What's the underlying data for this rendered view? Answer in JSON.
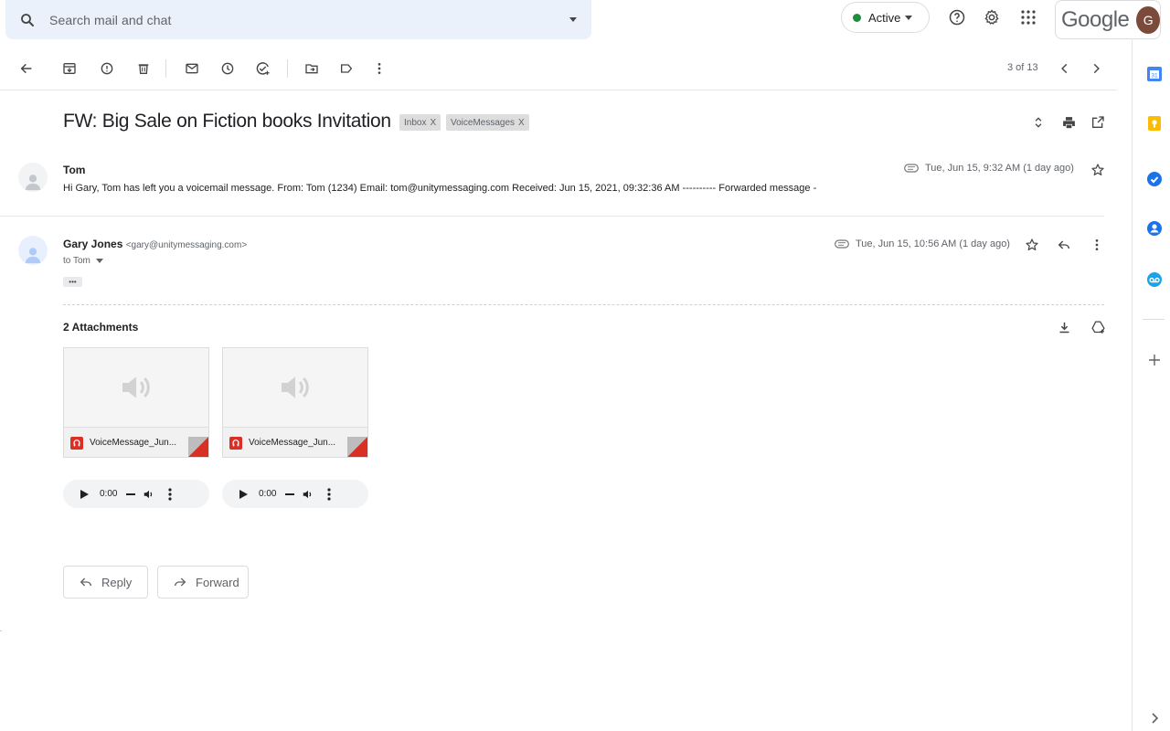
{
  "search": {
    "placeholder": "Search mail and chat"
  },
  "header": {
    "status": "Active",
    "status_color": "#1e8e3e",
    "brand": "Google",
    "avatar_letter": "G",
    "avatar_color": "#7b4a3a"
  },
  "toolbar": {
    "icons": [
      "back-arrow-icon",
      "archive-icon",
      "report-spam-icon",
      "delete-icon",
      "mark-unread-icon",
      "snooze-icon",
      "add-to-tasks-icon",
      "move-to-icon",
      "label-icon",
      "more-vert-icon"
    ],
    "pager": "3 of 13"
  },
  "thread": {
    "subject": "FW: Big Sale on Fiction books Invitation",
    "labels": [
      {
        "name": "Inbox",
        "remove": "X"
      },
      {
        "name": "VoiceMessages",
        "remove": "X"
      }
    ]
  },
  "messages": [
    {
      "sender": "Tom",
      "date": "Tue, Jun 15, 9:32 AM (1 day ago)",
      "snippet": "Hi Gary, Tom has left you a voicemail message. From: Tom (1234) Email: tom@unitymessaging.com Received: Jun 15, 2021, 09:32:36 AM ---------- Forwarded message -"
    },
    {
      "sender": "Gary Jones",
      "email": "<gary@unitymessaging.com>",
      "to": "to Tom",
      "date": "Tue, Jun 15, 10:56 AM (1 day ago)",
      "trimmed": "•••"
    }
  ],
  "attachments": {
    "title": "2 Attachments",
    "files": [
      {
        "name": "VoiceMessage_Jun...",
        "time": "0:00"
      },
      {
        "name": "VoiceMessage_Jun...",
        "time": "0:00"
      }
    ]
  },
  "actions": {
    "reply": "Reply",
    "forward": "Forward"
  },
  "rail": {
    "icons": [
      "calendar-icon",
      "keep-icon",
      "tasks-icon",
      "contacts-icon",
      "voicemail-icon",
      "add-icon",
      "expand-icon"
    ],
    "colors": {
      "calendar": "#4285f4",
      "keep": "#fbbc04",
      "tasks": "#1a73e8",
      "contacts": "#1a73e8",
      "voicemail": "#1aa3e8"
    }
  }
}
